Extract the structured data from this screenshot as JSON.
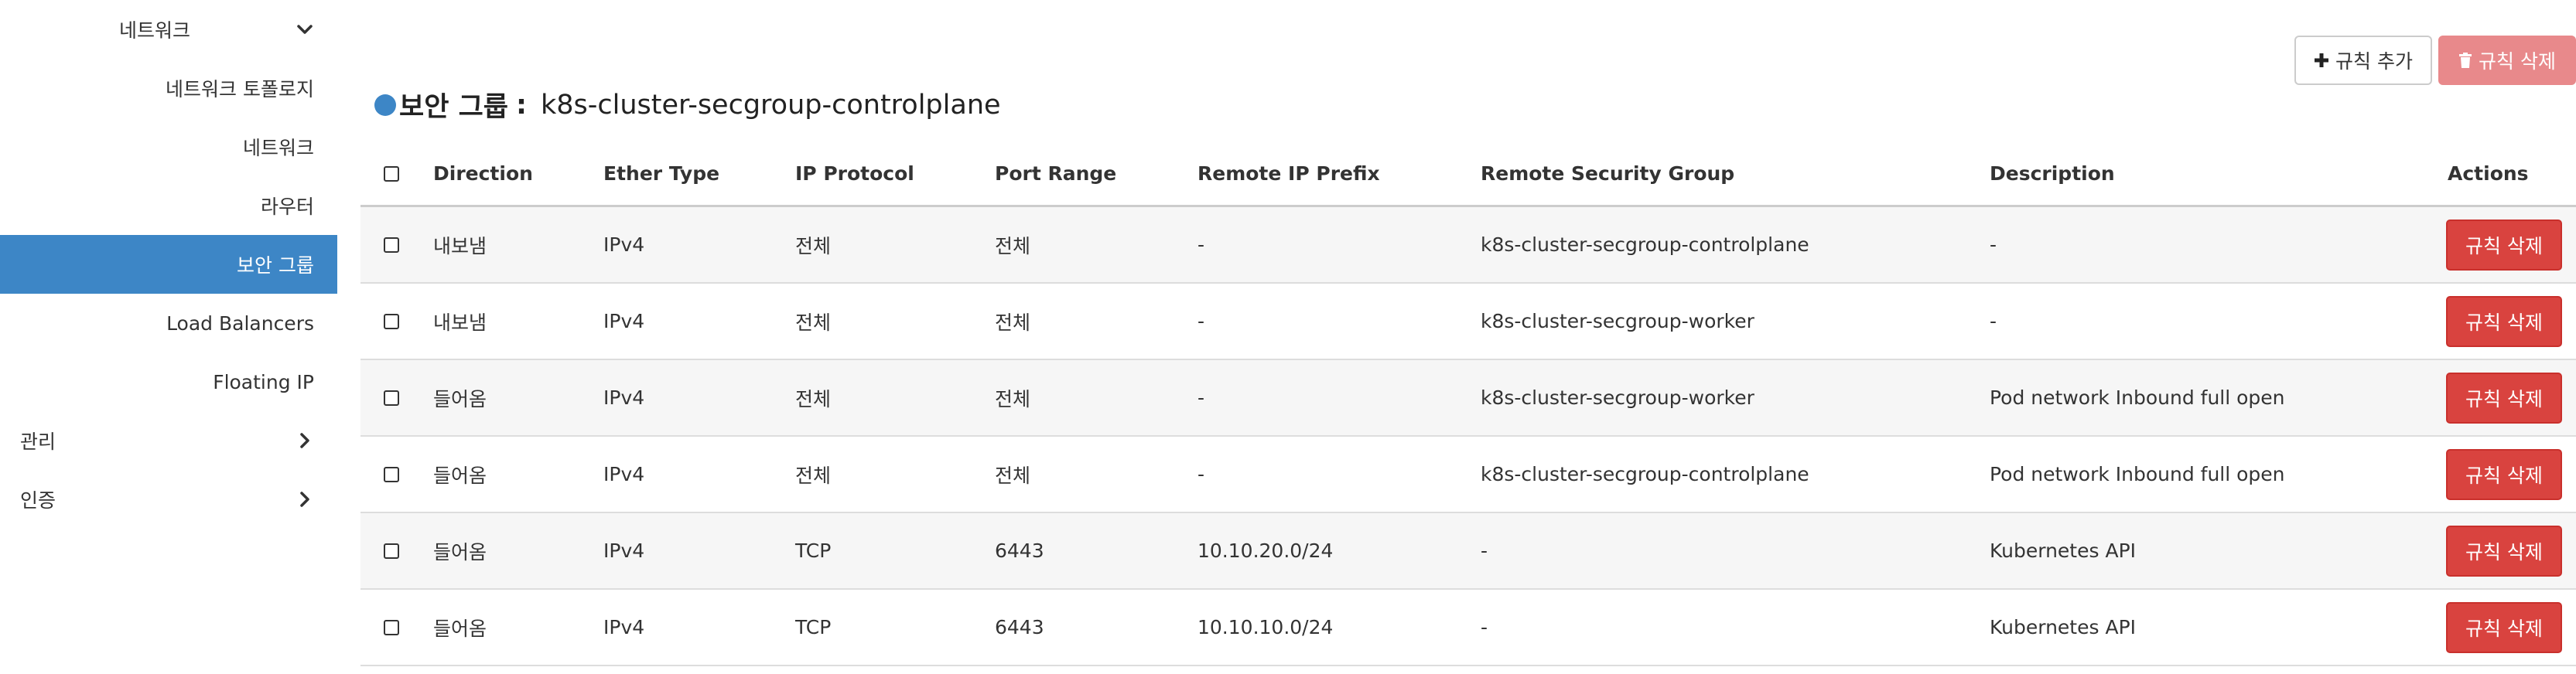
{
  "sidebar": {
    "network_group": "네트워크",
    "items": [
      {
        "label": "네트워크 토폴로지"
      },
      {
        "label": "네트워크"
      },
      {
        "label": "라우터"
      },
      {
        "label": "보안 그룹",
        "active": true
      },
      {
        "label": "Load Balancers"
      },
      {
        "label": "Floating IP"
      }
    ],
    "admin_group": "관리",
    "auth_group": "인증"
  },
  "header": {
    "title_label": "보안 그룹",
    "title_sep": ":",
    "title_value": "k8s-cluster-secgroup-controlplane",
    "add_rule_label": "규칙 추가",
    "delete_rule_label": "규칙 삭제"
  },
  "table": {
    "columns": [
      "Direction",
      "Ether Type",
      "IP Protocol",
      "Port Range",
      "Remote IP Prefix",
      "Remote Security Group",
      "Description",
      "Actions"
    ],
    "rows": [
      {
        "direction": "내보냄",
        "ether": "IPv4",
        "protocol": "전체",
        "port": "전체",
        "prefix": "-",
        "group": "k8s-cluster-secgroup-controlplane",
        "desc": "-",
        "action": "규칙 삭제"
      },
      {
        "direction": "내보냄",
        "ether": "IPv4",
        "protocol": "전체",
        "port": "전체",
        "prefix": "-",
        "group": "k8s-cluster-secgroup-worker",
        "desc": "-",
        "action": "규칙 삭제"
      },
      {
        "direction": "들어옴",
        "ether": "IPv4",
        "protocol": "전체",
        "port": "전체",
        "prefix": "-",
        "group": "k8s-cluster-secgroup-worker",
        "desc": "Pod network Inbound full open",
        "action": "규칙 삭제"
      },
      {
        "direction": "들어옴",
        "ether": "IPv4",
        "protocol": "전체",
        "port": "전체",
        "prefix": "-",
        "group": "k8s-cluster-secgroup-controlplane",
        "desc": "Pod network Inbound full open",
        "action": "규칙 삭제"
      },
      {
        "direction": "들어옴",
        "ether": "IPv4",
        "protocol": "TCP",
        "port": "6443",
        "prefix": "10.10.20.0/24",
        "group": "-",
        "desc": "Kubernetes API",
        "action": "규칙 삭제"
      },
      {
        "direction": "들어옴",
        "ether": "IPv4",
        "protocol": "TCP",
        "port": "6443",
        "prefix": "10.10.10.0/24",
        "group": "-",
        "desc": "Kubernetes API",
        "action": "규칙 삭제"
      }
    ]
  },
  "colors": {
    "accent": "#3d86c6",
    "danger": "#d9433f",
    "danger_disabled": "#e8898b"
  }
}
